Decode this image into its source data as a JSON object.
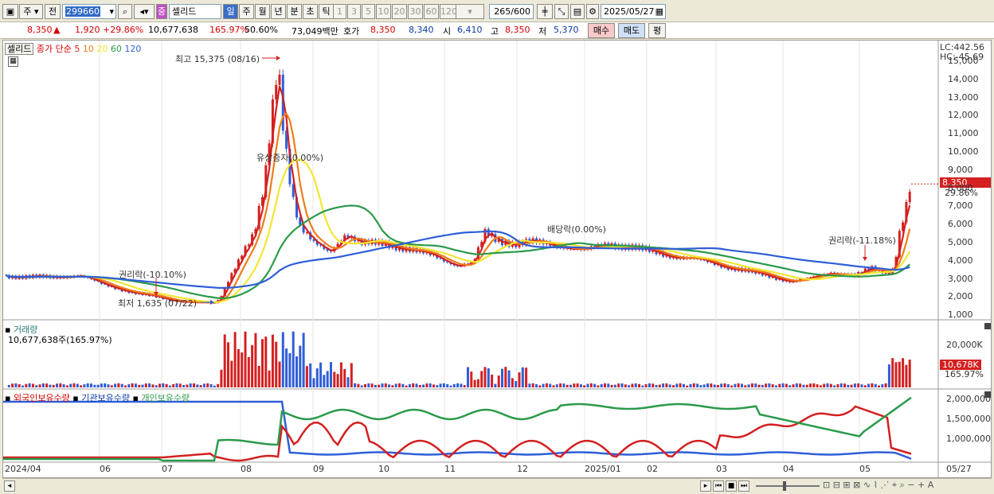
{
  "toolbar": {
    "type_label": "주",
    "prev_label": "전",
    "code_value": "299660",
    "stock_name_badge": "중",
    "stock_name": "셀리드",
    "periods": [
      "일",
      "주",
      "월",
      "년",
      "분",
      "초",
      "틱"
    ],
    "active_period": "일",
    "intervals": [
      "1",
      "3",
      "5",
      "10",
      "20",
      "30",
      "60",
      "120"
    ],
    "count_value": "265",
    "count_total": "/600",
    "date_value": "2025/05/27"
  },
  "quote": {
    "price": "8,350",
    "change": "1,920",
    "change_pct": "+29.86%",
    "volume": "10,677,638",
    "vol_ratio": "165.97%",
    "turnover": "50.60%",
    "amount": "73,049백만",
    "hoga_label": "호가",
    "ask": "8,350",
    "bid": "8,340",
    "open_label": "시",
    "open": "6,410",
    "high_label": "고",
    "high": "8,350",
    "low_label": "저",
    "low": "5,370",
    "buy_label": "매수",
    "sell_label": "매도",
    "avg_label": "평"
  },
  "price_panel": {
    "name_tag": "셀리드",
    "ma_prefix": "종가 단순",
    "ma_periods": [
      "5",
      "10",
      "20",
      "60",
      "120"
    ],
    "ma_colors": [
      "#d42020",
      "#ee7d1a",
      "#f2e632",
      "#2a9a4a",
      "#2f5ed8"
    ],
    "lc": "LC:442.56",
    "hc": "HC:-45.69",
    "high_note": "최고 15,375 (08/16)",
    "low_note": "최저 1,635 (07/22)",
    "ann_rights1": "권리락(-10.10%)",
    "ann_capital": "유상증자(0.00%)",
    "ann_dividend": "배당락(0.00%)",
    "ann_rights2": "권리락(-11.18%)",
    "price_tag": "8,350",
    "pct_tag": "29.86%",
    "y_ticks": [
      "15,000",
      "14,000",
      "13,000",
      "12,000",
      "11,000",
      "10,000",
      "9,000",
      "8,000",
      "7,000",
      "6,000",
      "5,000",
      "4,000",
      "3,000",
      "2,000",
      "1,000"
    ]
  },
  "volume_panel": {
    "title": "거래량",
    "value": "10,677,638주(165.97%)",
    "y_tick": "20,000K",
    "tag": "10,678K",
    "tag_pct": "165.97%"
  },
  "holdings_panel": {
    "series": [
      "외국인보유수량",
      "기관보유수량",
      "개인보유수량"
    ],
    "colors": [
      "#d42020",
      "#2f5ed8",
      "#2a9a4a"
    ],
    "y_ticks": [
      "2,000,000",
      "1,500,000",
      "1,000,000"
    ]
  },
  "x_axis": [
    "2024/04",
    "06",
    "07",
    "08",
    "09",
    "10",
    "11",
    "12",
    "2025/01",
    "02",
    "03",
    "04",
    "05",
    "05/27"
  ],
  "chart_data": {
    "type": "line",
    "title": "셀리드",
    "x": [
      "2024/04",
      "2024/06",
      "2024/07",
      "2024/08",
      "2024/09",
      "2024/10",
      "2024/11",
      "2024/12",
      "2025/01",
      "2025/02",
      "2025/03",
      "2025/04",
      "2025/05",
      "2025/05/27"
    ],
    "series": [
      {
        "name": "5",
        "values": [
          3200,
          2900,
          1900,
          11800,
          5200,
          4900,
          4100,
          4900,
          4800,
          4300,
          3300,
          2950,
          3600,
          8350
        ]
      },
      {
        "name": "120",
        "values": [
          3350,
          3000,
          2700,
          3100,
          3900,
          4300,
          4500,
          4800,
          5100,
          5000,
          4600,
          4200,
          4100,
          4100
        ]
      }
    ],
    "ylim": [
      1000,
      15500
    ],
    "high": 15375,
    "low": 1635,
    "last": 8350
  }
}
